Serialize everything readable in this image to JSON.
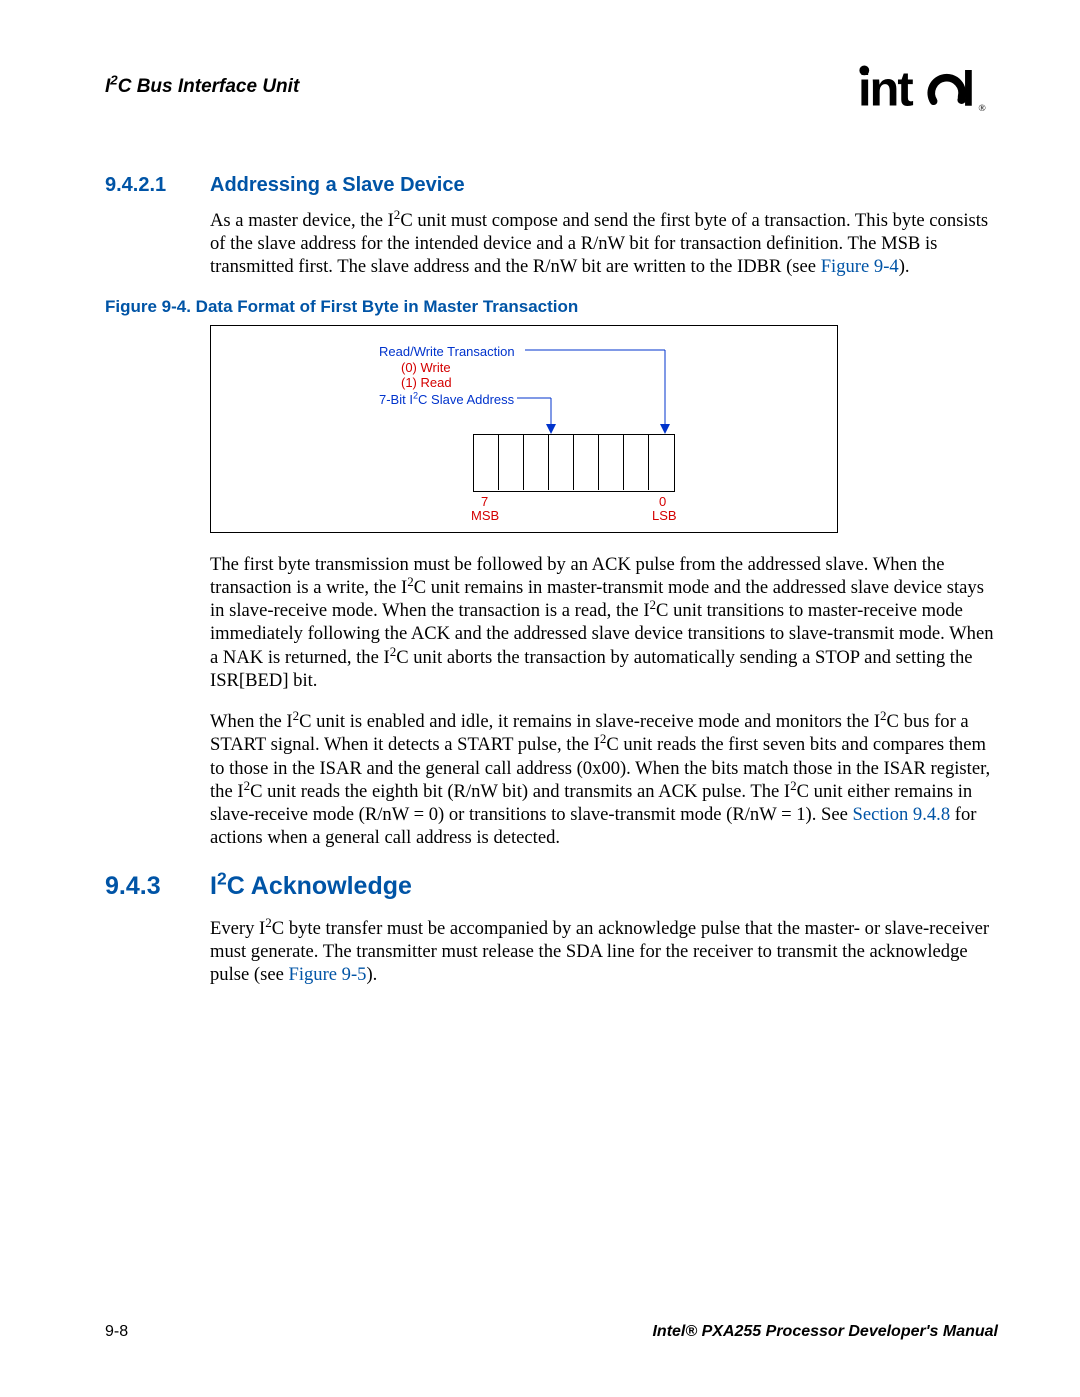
{
  "header": {
    "title_pre": "I",
    "title_sup": "2",
    "title_post": "C Bus Interface Unit",
    "logo_alt": "intel"
  },
  "sec1": {
    "num": "9.4.2.1",
    "title": "Addressing a Slave Device"
  },
  "para1": {
    "a": "As a master device, the I",
    "sup1": "2",
    "b": "C unit must compose and send the first byte of a transaction. This byte consists of the slave address for the intended device and a R/nW bit for transaction definition. The MSB is transmitted first. The slave address and the R/nW bit are written to the IDBR (see ",
    "link": "Figure 9-4",
    "c": ")."
  },
  "figure": {
    "caption": "Figure 9-4. Data Format of First Byte in Master Transaction",
    "rw_label": "Read/Write Transaction",
    "write": "(0) Write",
    "read": "(1) Read",
    "addr_pre": "7-Bit I",
    "addr_sup": "2",
    "addr_post": "C Slave Address",
    "msb_num": "7",
    "msb": "MSB",
    "lsb_num": "0",
    "lsb": "LSB"
  },
  "para2": {
    "a": "The first byte transmission must be followed by an ACK pulse from the addressed slave. When the transaction is a write, the I",
    "sup1": "2",
    "b": "C unit remains in master-transmit mode and the addressed slave device stays in slave-receive mode. When the transaction is a read, the I",
    "sup2": "2",
    "c": "C unit transitions to master-receive mode immediately following the ACK and the addressed slave device transitions to slave-transmit mode. When a NAK is returned, the I",
    "sup3": "2",
    "d": "C unit aborts the transaction by automatically sending a STOP and setting the ISR[BED] bit."
  },
  "para3": {
    "a": "When the I",
    "sup1": "2",
    "b": "C unit is enabled and idle, it remains in slave-receive mode and monitors the I",
    "sup2": "2",
    "c": "C bus for a START signal. When it detects a START pulse, the I",
    "sup3": "2",
    "d": "C unit reads the first seven bits and compares them to those in the ISAR and the general call address (0x00). When the bits match those in the ISAR register, the I",
    "sup4": "2",
    "e": "C unit reads the eighth bit (R/nW bit) and transmits an ACK pulse. The I",
    "sup5": "2",
    "f": "C unit either remains in slave-receive mode (R/nW = 0) or transitions to slave-transmit mode (R/nW = 1). See ",
    "link": "Section 9.4.8",
    "g": " for actions when a general call address is detected."
  },
  "sec2": {
    "num": "9.4.3",
    "title_pre": "I",
    "title_sup": "2",
    "title_post": "C Acknowledge"
  },
  "para4": {
    "a": "Every I",
    "sup1": "2",
    "b": "C byte transfer must be accompanied by an acknowledge pulse that the master- or slave-receiver must generate. The transmitter must release the SDA line for the receiver to transmit the acknowledge pulse (see ",
    "link": "Figure 9-5",
    "c": ")."
  },
  "footer": {
    "pagenum": "9-8",
    "manual": "Intel® PXA255 Processor Developer's Manual"
  }
}
